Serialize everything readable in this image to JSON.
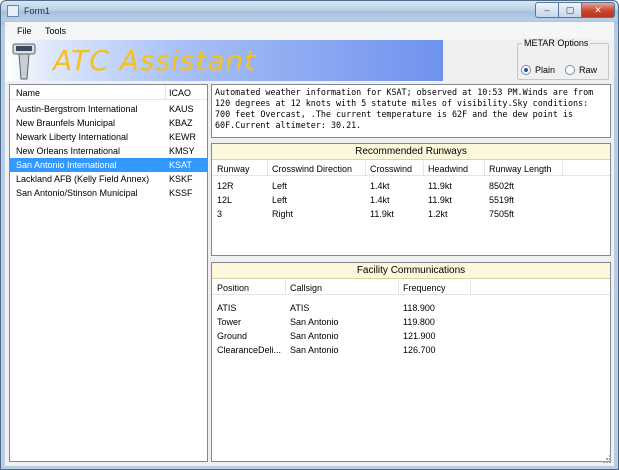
{
  "window": {
    "title": "Form1",
    "min": "‒",
    "max": "▢",
    "close": "✕"
  },
  "menu": [
    "File",
    "Tools"
  ],
  "banner": {
    "title": "ATC  Assistant"
  },
  "metar_options": {
    "label": "METAR  Options",
    "options": [
      "Plain",
      "Raw"
    ],
    "selected": "Plain"
  },
  "airport_list": {
    "columns": [
      "Name",
      "ICAO"
    ],
    "rows": [
      {
        "name": "Austin-Bergstrom  International",
        "icao": "KAUS",
        "selected": false
      },
      {
        "name": "New  Braunfels  Municipal",
        "icao": "KBAZ",
        "selected": false
      },
      {
        "name": "Newark  Liberty  International",
        "icao": "KEWR",
        "selected": false
      },
      {
        "name": "New  Orleans  International",
        "icao": "KMSY",
        "selected": false
      },
      {
        "name": "San  Antonio  International",
        "icao": "KSAT",
        "selected": true
      },
      {
        "name": "Lackland  AFB  (Kelly  Field  Annex)",
        "icao": "KSKF",
        "selected": false
      },
      {
        "name": "San  Antonio/Stinson  Municipal",
        "icao": "KSSF",
        "selected": false
      }
    ]
  },
  "metar_text": "Automated weather information for KSAT; observed at 10:53 PM.Winds are from 120 degrees at 12 knots with 5 statute miles of visibility.Sky conditions: 700 feet Overcast, .The current temperature is 62F and the dew point is 60F.Current altimeter: 30.21.",
  "runways": {
    "title": "Recommended  Runways",
    "columns": [
      "Runway",
      "Crosswind  Direction",
      "Crosswind",
      "Headwind",
      "Runway  Length"
    ],
    "rows": [
      [
        "12R",
        "Left",
        "1.4kt",
        "11.9kt",
        "8502ft"
      ],
      [
        "12L",
        "Left",
        "1.4kt",
        "11.9kt",
        "5519ft"
      ],
      [
        "3",
        "Right",
        "11.9kt",
        "1.2kt",
        "7505ft"
      ]
    ]
  },
  "comms": {
    "title": "Facility  Communications",
    "columns": [
      "Position",
      "Callsign",
      "Frequency"
    ],
    "rows": [
      [
        "ATIS",
        "ATIS",
        "118.900"
      ],
      [
        "Tower",
        "San  Antonio",
        "119.800"
      ],
      [
        "Ground",
        "San  Antonio",
        "121.900"
      ],
      [
        "ClearanceDeli...",
        "San  Antonio",
        "126.700"
      ]
    ]
  },
  "colors": {
    "selection": "#3399ff",
    "banner_text": "#f6c11d",
    "panel_title_bg": "#fcf8dc"
  }
}
